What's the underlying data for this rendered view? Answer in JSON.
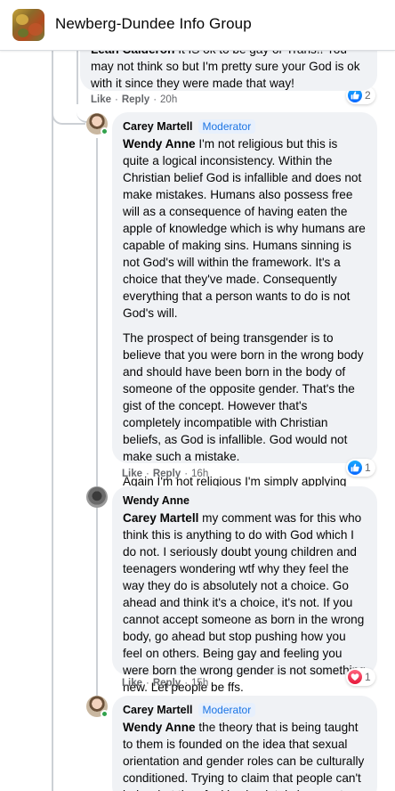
{
  "header": {
    "group_name": "Newberg-Dundee Info Group"
  },
  "comments": [
    {
      "author": "Lean Calderon",
      "text": "It IS ok to be gay or Trans!! You may not think so but I'm pretty sure your God is ok with it since they were made that way!",
      "like_label": "Like",
      "reply_label": "Reply",
      "time": "20h",
      "reaction_count": "2"
    },
    {
      "author": "Carey Martell",
      "badge": "Moderator",
      "mention": "Wendy Anne",
      "paragraph1": "I'm not religious but this is quite a logical inconsistency. Within the Christian belief God is infallible and does not make mistakes. Humans also possess free will as a consequence of having eaten the apple of knowledge which is why humans are capable of making sins. Humans sinning is not God's will within the framework. It's a choice that they've made. Consequently everything that a person wants to do is not God's will.",
      "paragraph2": "The prospect of being transgender is to believe that you were born in the wrong body and should have been born in the body of someone of the opposite gender. That's the gist of the concept. However that's completely incompatible with Christian beliefs, as God is infallible. God would not make such a mistake.",
      "paragraph3": "Again I'm not religious I'm simply applying logic to your own beliefs",
      "like_label": "Like",
      "reply_label": "Reply",
      "time": "16h",
      "reaction_count": "1"
    },
    {
      "author": "Wendy Anne",
      "mention": "Carey Martell",
      "text": "my comment was for this who think this is anything to do with God which I do not. I seriously doubt young children and teenagers wondering wtf why they feel the way they do is absolutely not a choice. Go ahead and think it's a choice, it's not. If you cannot accept someone as born in the wrong body, go ahead but stop pushing how you feel on others. Being gay and feeling you were born the wrong gender is not something new. Let people be ffs.",
      "like_label": "Like",
      "reply_label": "Reply",
      "time": "15h",
      "reaction_count": "1"
    },
    {
      "author": "Carey Martell",
      "badge": "Moderator",
      "mention": "Wendy Anne",
      "text": "the theory that is being taught to them is founded on the idea that sexual orientation and gender roles can be culturally conditioned. Trying to claim that people can't help what they feel is absolutely incorrect."
    }
  ],
  "icons": {
    "like": "thumbs-up-icon",
    "love": "heart-icon"
  },
  "colors": {
    "link_blue": "#1b74e4",
    "like_blue": "#0866ff",
    "love_red": "#e61739",
    "online_green": "#31a24c"
  }
}
